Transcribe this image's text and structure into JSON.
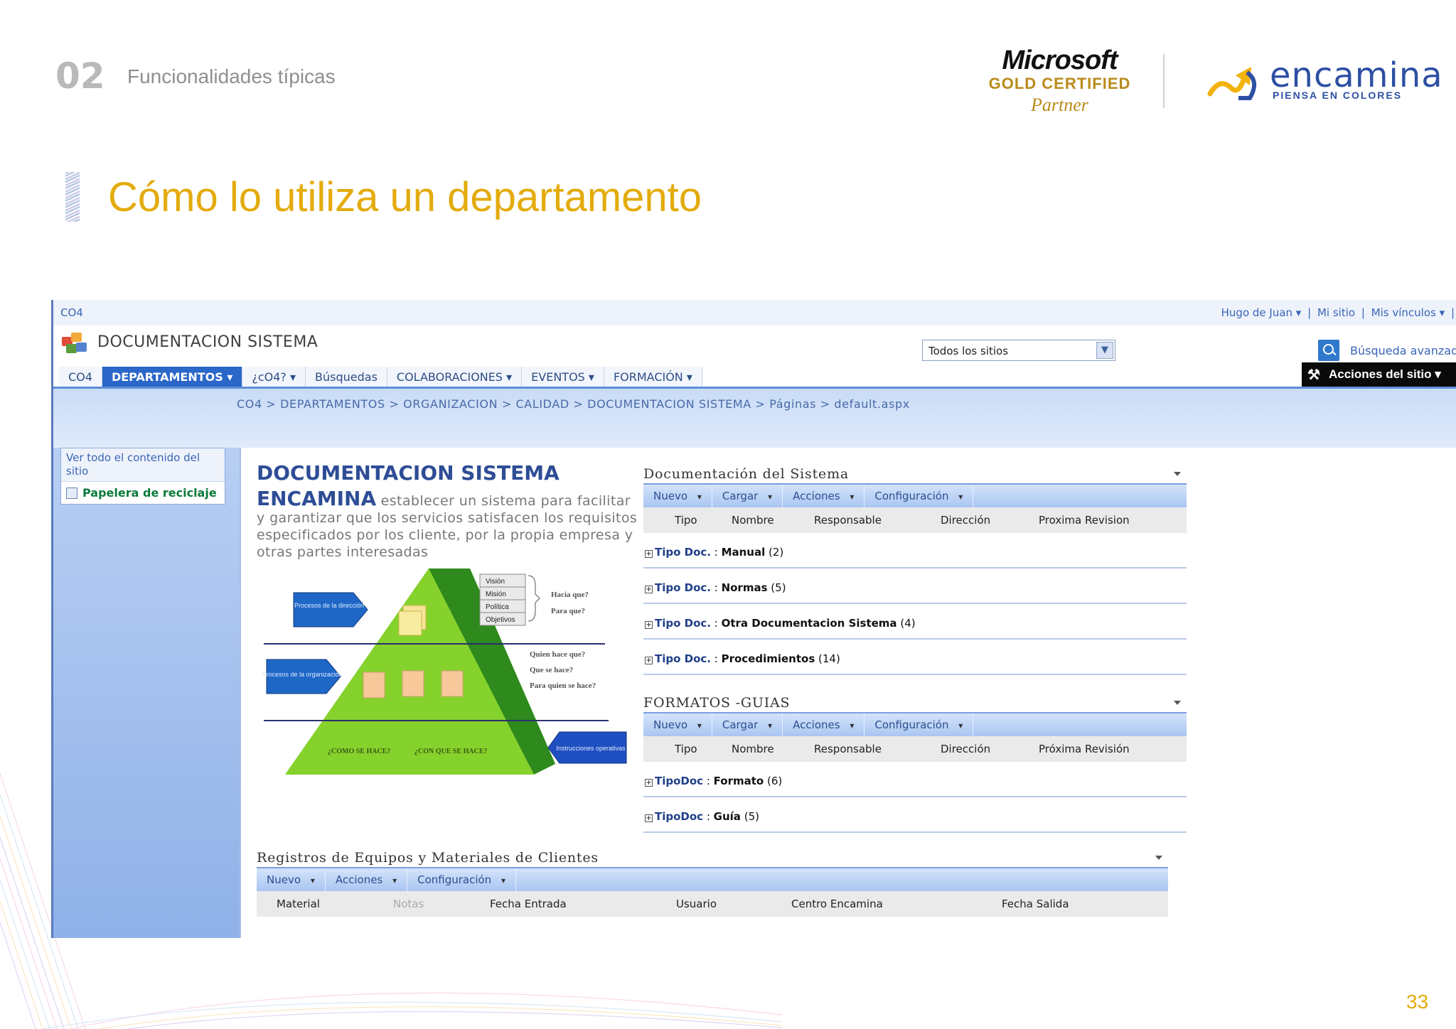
{
  "slide": {
    "number": "02",
    "section": "Funcionalidades típicas",
    "title": "Cómo lo utiliza un departamento",
    "page_number": "33"
  },
  "logos": {
    "microsoft": {
      "word": "Microsoft",
      "certified": "GOLD CERTIFIED",
      "partner": "Partner"
    },
    "encamina": {
      "word": "encamina",
      "tagline": "PIENSA EN COLORES"
    }
  },
  "sharepoint": {
    "site_crumb": "CO4",
    "user_links": [
      "Hugo de Juan ▾",
      "|",
      "Mi sitio",
      "|",
      "Mis vínculos ▾",
      "|"
    ],
    "site_title": "DOCUMENTACION SISTEMA",
    "search_scope": "Todos los sitios",
    "advanced_search": "Búsqueda avanzad",
    "site_actions": "Acciones del sitio",
    "nav": [
      "CO4",
      "DEPARTAMENTOS ▾",
      "¿cO4? ▾",
      "Búsquedas",
      "COLABORACIONES ▾",
      "EVENTOS ▾",
      "FORMACIÓN ▾"
    ],
    "breadcrumb": "CO4 > DEPARTAMENTOS > ORGANIZACION > CALIDAD > DOCUMENTACION SISTEMA > Páginas > default.aspx",
    "quick_launch": {
      "view_all": "Ver todo el contenido del sitio",
      "recycle_bin": "Papelera de reciclaje"
    },
    "intro": {
      "heading": "DOCUMENTACION SISTEMA",
      "brand": "ENCAMINA",
      "text": "establecer un sistema para facilitar y garantizar que los servicios satisfacen los requisitos especificados por los cliente, por la propia empresa y otras partes interesadas"
    },
    "diagram": {
      "left_top": "Procesos de la dirección",
      "left_mid": "Procesos de la organización",
      "boxes": [
        "Visión",
        "Misión",
        "Política",
        "Objetivos"
      ],
      "hacia": "Hacia que?",
      "para": "Para que?",
      "quien": "Quien hace que?",
      "que": "Que se hace?",
      "para_quien": "Para quien se hace?",
      "como": "¿COMO SE HACE?",
      "con_que": "¿CON QUE SE HACE?",
      "instrucciones": "Instrucciones operativas"
    },
    "doc_library": {
      "title": "Documentación del Sistema",
      "toolbar": [
        "Nuevo",
        "Cargar",
        "Acciones",
        "Configuración"
      ],
      "columns": [
        "Tipo",
        "Nombre",
        "Responsable",
        "Dirección",
        "Proxima Revision"
      ],
      "groups": [
        {
          "key": "Tipo Doc.",
          "value": "Manual",
          "count": "(2)"
        },
        {
          "key": "Tipo Doc.",
          "value": "Normas",
          "count": "(5)"
        },
        {
          "key": "Tipo Doc.",
          "value": "Otra Documentacion Sistema",
          "count": "(4)"
        },
        {
          "key": "Tipo Doc.",
          "value": "Procedimientos",
          "count": "(14)"
        }
      ]
    },
    "forms_library": {
      "title": "FORMATOS -GUIAS",
      "toolbar": [
        "Nuevo",
        "Cargar",
        "Acciones",
        "Configuración"
      ],
      "columns": [
        "Tipo",
        "Nombre",
        "Responsable",
        "Dirección",
        "Próxima Revisión"
      ],
      "groups": [
        {
          "key": "TipoDoc",
          "value": "Formato",
          "count": "(6)"
        },
        {
          "key": "TipoDoc",
          "value": "Guía",
          "count": "(5)"
        }
      ]
    },
    "records_list": {
      "title": "Registros de Equipos y Materiales de Clientes",
      "toolbar": [
        "Nuevo",
        "Acciones",
        "Configuración"
      ],
      "columns": [
        "Material",
        "Notas",
        "Fecha Entrada",
        "Usuario",
        "Centro Encamina",
        "Fecha Salida"
      ]
    }
  }
}
